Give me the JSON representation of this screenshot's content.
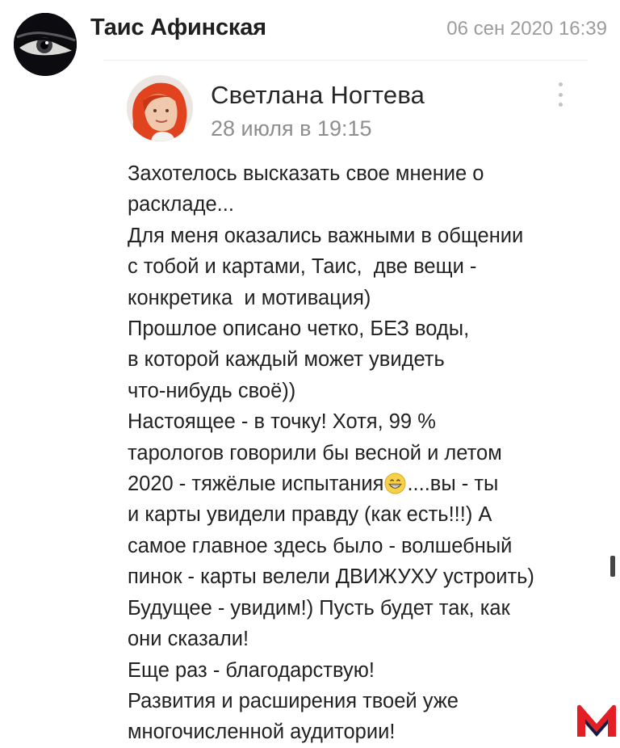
{
  "post": {
    "author": "Таис Афинская",
    "date": "06 сен 2020 16:39",
    "avatar_icon": "eye-avatar-icon"
  },
  "quoted_comment": {
    "author": "Светлана Ногтева",
    "date": "28 июля в 19:15",
    "menu_icon": "more-vertical-icon",
    "avatar_icon": "red-hair-avatar-icon",
    "lines": [
      "Захотелось высказать свое мнение о",
      "раскладе...",
      "Для меня оказались важными в общении",
      "с тобой и картами, Таис,  две вещи -",
      "конкретика  и мотивация)",
      "Прошлое описано четко, БЕЗ воды,",
      "в которой каждый может увидеть",
      "что-нибудь своё))",
      "Настоящее - в точку! Хотя, 99 %",
      "тарологов говорили бы весной и летом",
      "2020 - тяжёлые испытания",
      "и карты увидели правду (как есть!!!) А",
      "самое главное здесь было - волшебный",
      "пинок - карты велели ДВИЖУХУ устроить)",
      "Будущее - увидим!) Пусть будет так, как",
      "они сказали!",
      "Еще раз - благодарствую!",
      "Развития и расширения твоей уже",
      "многочисленной аудитории!"
    ],
    "emoji_line_tail": "....вы - ты",
    "emoji_icon": "grinning-face-emoji-icon"
  },
  "watermark": {
    "icon": "red-m-logo-icon",
    "color": "#e31e24"
  },
  "colors": {
    "author": "#1f1f1f",
    "date": "#9c9c9c",
    "text": "#222222"
  }
}
